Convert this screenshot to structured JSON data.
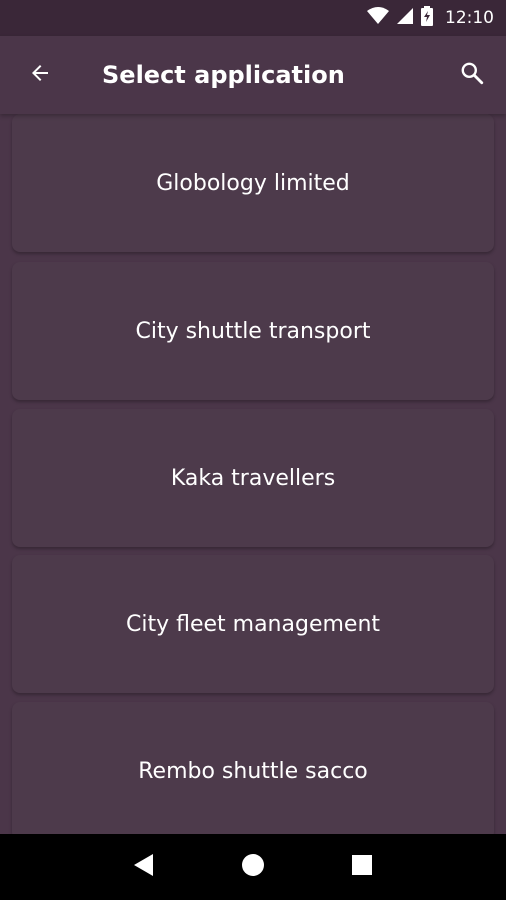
{
  "status_bar": {
    "time": "12:10",
    "icons": [
      "wifi-icon",
      "cell-signal-icon",
      "battery-charging-icon"
    ]
  },
  "app_bar": {
    "title": "Select application",
    "back_icon": "arrow-left-icon",
    "search_icon": "search-icon"
  },
  "applications": [
    {
      "name": "Globology limited"
    },
    {
      "name": "City shuttle transport"
    },
    {
      "name": "Kaka travellers"
    },
    {
      "name": "City fleet management"
    },
    {
      "name": "Rembo shuttle sacco"
    }
  ],
  "nav_bar": {
    "icons": [
      "back-triangle-icon",
      "home-circle-icon",
      "recents-square-icon"
    ]
  },
  "colors": {
    "background": "#4b3649",
    "status_bar": "#3a2738",
    "card": "#4d3a4b",
    "text": "#ffffff",
    "nav_bar": "#000000"
  }
}
